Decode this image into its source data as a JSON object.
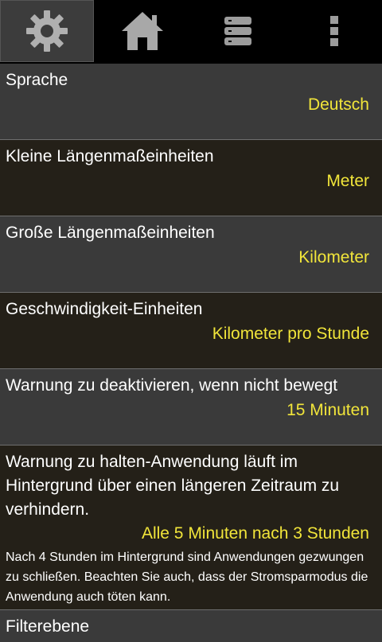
{
  "toolbar": {
    "tabs": [
      {
        "icon": "gear-icon",
        "active": true
      },
      {
        "icon": "home-icon",
        "active": false
      },
      {
        "icon": "storage-icon",
        "active": false
      },
      {
        "icon": "more-icon",
        "active": false
      }
    ]
  },
  "settings": [
    {
      "label": "Sprache",
      "value": "Deutsch"
    },
    {
      "label": "Kleine Längenmaßeinheiten",
      "value": "Meter"
    },
    {
      "label": "Große Längenmaßeinheiten",
      "value": "Kilometer"
    },
    {
      "label": "Geschwindigkeit-Einheiten",
      "value": "Kilometer pro Stunde"
    },
    {
      "label": "Warnung zu deaktivieren, wenn nicht bewegt",
      "value": "15 Minuten"
    },
    {
      "label": "Warnung zu halten-Anwendung läuft im Hintergrund über einen längeren Zeitraum zu verhindern.",
      "value": "Alle 5 Minuten nach 3 Stunden",
      "note": "Nach 4 Stunden im Hintergrund sind Anwendungen gezwungen zu schließen.  Beachten Sie auch, dass der Stromsparmodus die Anwendung auch töten kann."
    },
    {
      "label": "Filterebene"
    }
  ],
  "colors": {
    "value_text": "#f1e53a",
    "row_light": "#3a3a3a",
    "row_dark": "#242018",
    "active_tab": "#3c3c3c",
    "icon_gray": "#aaaaaa"
  }
}
